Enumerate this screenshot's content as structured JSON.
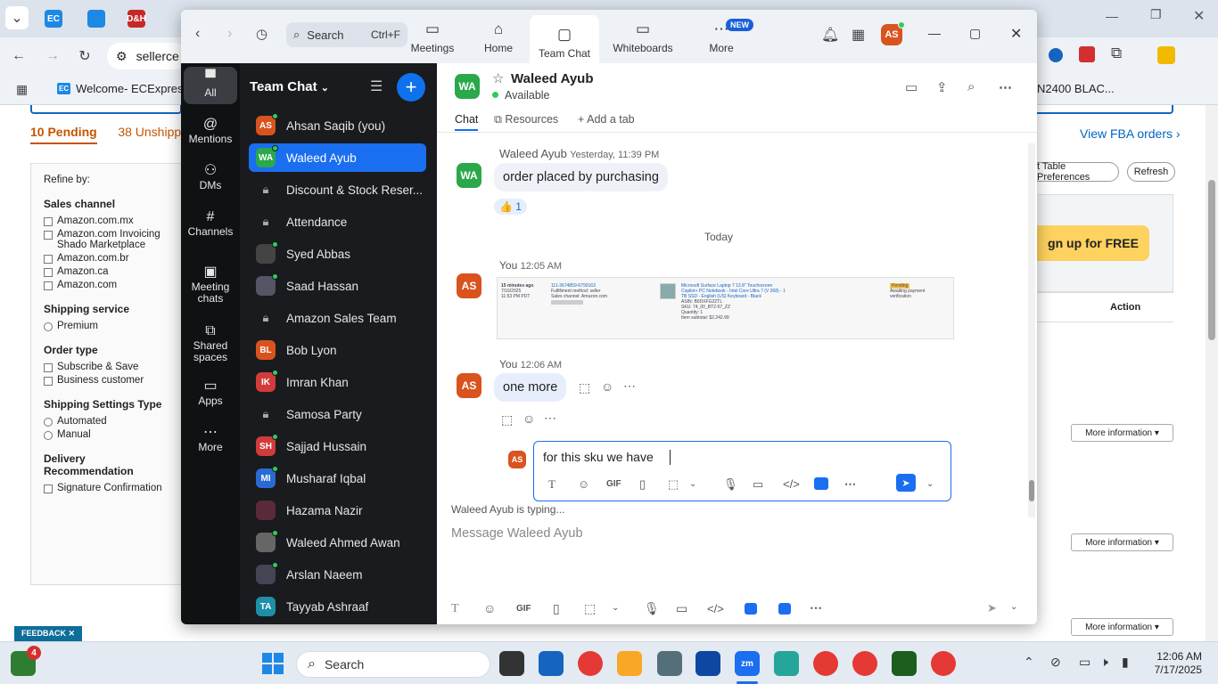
{
  "browser": {
    "address": "sellerce",
    "bookmark": "Welcome- ECExpres...",
    "bookmark_right": "N2400 BLAC...",
    "tab_icons": [
      "EC",
      "D&H"
    ]
  },
  "seller": {
    "tabs": [
      "10 Pending",
      "38 Unshippe"
    ],
    "refine_title": "Refine by:",
    "sections": [
      {
        "title": "Sales channel",
        "type": "checkbox",
        "options": [
          "Amazon.com.mx",
          "Amazon.com Invoicing Shado Marketplace",
          "Amazon.com.br",
          "Amazon.ca",
          "Amazon.com"
        ]
      },
      {
        "title": "Shipping service",
        "type": "radio",
        "options": [
          "Premium"
        ]
      },
      {
        "title": "Order type",
        "type": "checkbox",
        "options": [
          "Subscribe & Save",
          "Business customer"
        ]
      },
      {
        "title": "Shipping Settings Type",
        "type": "radio",
        "options": [
          "Automated",
          "Manual"
        ]
      },
      {
        "title": "Delivery Recommendation",
        "type": "checkbox",
        "options": [
          "Signature Confirmation"
        ]
      }
    ],
    "view_fba": "View FBA orders",
    "table_prefs": "t Table Preferences",
    "refresh": "Refresh",
    "signup": "gn up for FREE",
    "action_header": "Action",
    "more_info": "More information",
    "feedback": "FEEDBACK"
  },
  "zoom": {
    "search_label": "Search",
    "search_shortcut": "Ctrl+F",
    "nav": [
      {
        "label": "Meetings",
        "icon": "▭"
      },
      {
        "label": "Home",
        "icon": "⌂"
      },
      {
        "label": "Team Chat",
        "icon": "▢"
      },
      {
        "label": "Whiteboards",
        "icon": "▭"
      },
      {
        "label": "More",
        "icon": "⋯"
      }
    ],
    "new_badge": "NEW",
    "user_initials": "AS",
    "rail": [
      {
        "label": "All",
        "icon": "▀"
      },
      {
        "label": "Mentions",
        "icon": "@"
      },
      {
        "label": "DMs",
        "icon": "⚇"
      },
      {
        "label": "Channels",
        "icon": "#"
      },
      {
        "label": "Meeting chats",
        "icon": "▣"
      },
      {
        "label": "Shared spaces",
        "icon": "⧉"
      },
      {
        "label": "Apps",
        "icon": "▭"
      },
      {
        "label": "More",
        "icon": "⋯"
      }
    ],
    "list_title": "Team Chat",
    "contacts": [
      {
        "name": "Ahsan Saqib (you)",
        "initials": "AS",
        "color": "#d9531e",
        "online": true,
        "kind": "avatar"
      },
      {
        "name": "Waleed Ayub",
        "initials": "WA",
        "color": "#2aa84a",
        "online": true,
        "kind": "avatar"
      },
      {
        "name": "Discount & Stock Reser...",
        "kind": "lock"
      },
      {
        "name": "Attendance",
        "kind": "lock"
      },
      {
        "name": "Syed Abbas",
        "initials": "",
        "color": "#444",
        "online": true,
        "kind": "avatar"
      },
      {
        "name": "Saad Hassan",
        "initials": "",
        "color": "#556",
        "online": true,
        "kind": "avatar"
      },
      {
        "name": "Amazon Sales Team",
        "kind": "lock"
      },
      {
        "name": "Bob Lyon",
        "initials": "BL",
        "color": "#d9531e",
        "online": false,
        "kind": "avatar"
      },
      {
        "name": "Imran Khan",
        "initials": "IK",
        "color": "#d23b3b",
        "online": true,
        "kind": "avatar"
      },
      {
        "name": "Samosa Party",
        "kind": "lock"
      },
      {
        "name": "Sajjad Hussain",
        "initials": "SH",
        "color": "#d23b3b",
        "online": true,
        "kind": "avatar"
      },
      {
        "name": "Musharaf Iqbal",
        "initials": "MI",
        "color": "#2a6bd1",
        "online": true,
        "kind": "avatar"
      },
      {
        "name": "Hazama Nazir",
        "initials": "",
        "color": "#5a2a3a",
        "online": false,
        "kind": "avatar"
      },
      {
        "name": "Waleed Ahmed Awan",
        "initials": "",
        "color": "#666",
        "online": true,
        "kind": "avatar"
      },
      {
        "name": "Arslan Naeem",
        "initials": "",
        "color": "#445",
        "online": true,
        "kind": "avatar"
      },
      {
        "name": "Tayyab Ashraaf",
        "initials": "TA",
        "color": "#1e8fa8",
        "online": false,
        "kind": "avatar"
      }
    ],
    "chat": {
      "initials": "WA",
      "name": "Waleed Ayub",
      "status": "Available",
      "tabs": [
        "Chat",
        "Resources",
        "Add a tab"
      ],
      "messages": [
        {
          "sender": "Waleed Ayub",
          "time": "Yesterday, 11:39 PM",
          "text": "order placed by purchasing",
          "reaction": "👍 1",
          "initials": "WA"
        },
        {
          "divider": "Today"
        },
        {
          "sender": "You",
          "time": "12:05 AM",
          "initials": "AS"
        },
        {
          "sender": "You",
          "time": "12:06 AM",
          "text": "one more",
          "initials": "AS"
        }
      ],
      "screenshot_text": {
        "row_time": "15 minutes ago",
        "order_id": "111-3674859-6790163",
        "date": "7/16/2025",
        "time": "11:53 PM PDT",
        "fulfillment": "Fulfillment method: seller",
        "sales_channel": "Sales channel: Amazon.com",
        "product": "Microsoft Surface Laptop 7 13.8\" Touchscreen",
        "product2": "Copilot+ PC Notebook - Intel Core Ultra 7 (V 268) - 1",
        "product3": "TB SSD - English (US) Keyboard - Black",
        "asin": "ASIN: B0DXFG2ZTL",
        "sku": "SKU: 74_00_BT2-67_ZZ",
        "qty": "Quantity: 1",
        "subtotal": "Item subtotal: $2,242.99",
        "status": "Pending",
        "status2": "Awaiting payment",
        "status3": "verification"
      },
      "reply_initials": "AS",
      "reply_text": "for this sku we have",
      "typing": "Waleed Ayub  is typing...",
      "placeholder": "Message Waleed Ayub"
    }
  },
  "taskbar": {
    "search": "Search",
    "time": "12:06 AM",
    "date": "7/17/2025",
    "notif_count": "4"
  }
}
